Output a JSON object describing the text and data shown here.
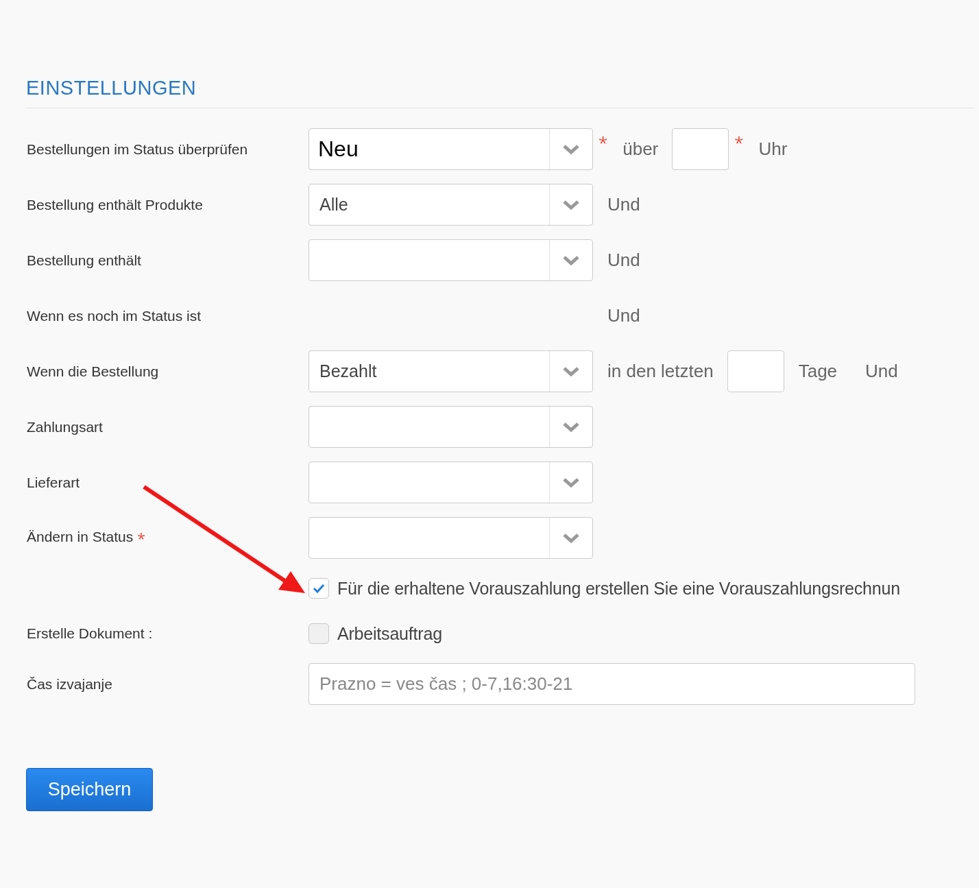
{
  "title": "EINSTELLUNGEN",
  "rows": [
    {
      "kind": "select",
      "label": "Bestellungen im Status überprüfen",
      "value": "Neu",
      "emphasized": true,
      "extras": [
        {
          "kind": "required",
          "text": "*"
        },
        {
          "kind": "text",
          "text": "über"
        },
        {
          "kind": "input"
        },
        {
          "kind": "required",
          "text": "*"
        },
        {
          "kind": "text",
          "text": "Uhr"
        }
      ]
    },
    {
      "kind": "select",
      "label": "Bestellung enthält Produkte",
      "value": "Alle",
      "emphasized": false,
      "extras": [
        {
          "kind": "text",
          "text": "Und"
        }
      ]
    },
    {
      "kind": "select",
      "label": "Bestellung enthält",
      "extras": [
        {
          "kind": "text",
          "text": "Und"
        }
      ]
    },
    {
      "kind": "plain",
      "label": "Wenn es noch im Status ist",
      "extras": [
        {
          "kind": "text",
          "text": "Und"
        }
      ]
    },
    {
      "kind": "select",
      "label": "Wenn die Bestellung",
      "value": "Bezahlt",
      "emphasized": false,
      "extras": [
        {
          "kind": "text",
          "text": "in den letzten"
        },
        {
          "kind": "input"
        },
        {
          "kind": "text",
          "text": "Tage"
        },
        {
          "kind": "text",
          "text": "Und"
        }
      ]
    },
    {
      "kind": "select",
      "label": "Zahlungsart"
    },
    {
      "kind": "select",
      "label": "Lieferart"
    },
    {
      "kind": "select",
      "label": "Ändern in Status",
      "required_mark": "*"
    },
    {
      "kind": "checkbox",
      "checked": true,
      "text": "Für die erhaltene Vorauszahlung erstellen Sie eine Vorauszahlungsrechnun"
    },
    {
      "kind": "checkbox",
      "label": "Erstelle Dokument :",
      "checked": false,
      "text": "Arbeitsauftrag"
    },
    {
      "kind": "text-input",
      "label": "Čas izvajanje",
      "placeholder": "Prazno = ves čas ; 0-7,16:30-21"
    }
  ],
  "save_button": "Speichern"
}
